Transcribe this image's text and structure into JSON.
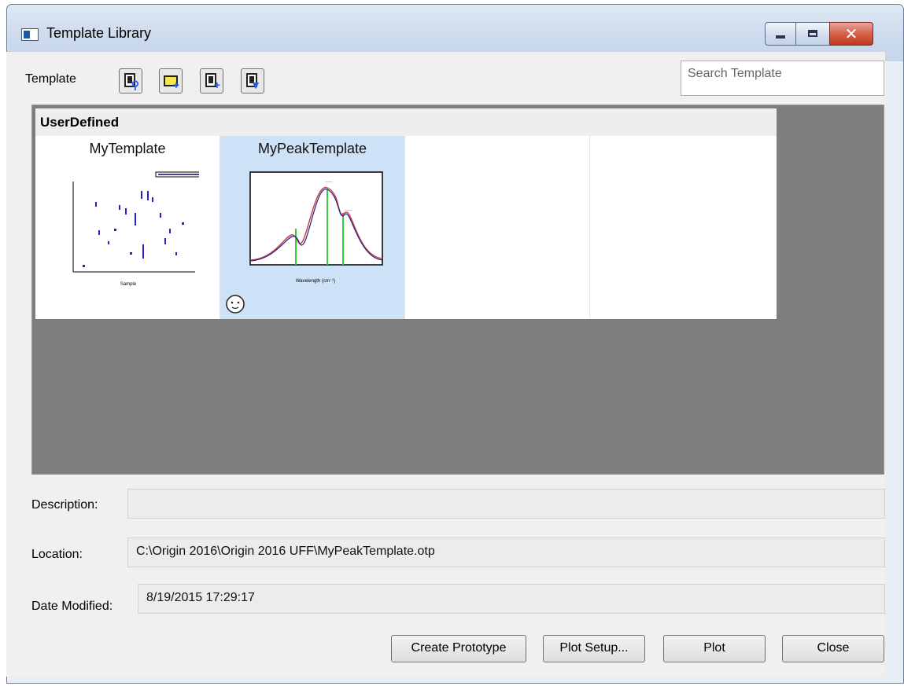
{
  "window": {
    "title": "Template Library"
  },
  "toolbar": {
    "label": "Template",
    "search_placeholder": "Search Template"
  },
  "gallery": {
    "group": "UserDefined",
    "templates": [
      {
        "name": "MyTemplate",
        "selected": false
      },
      {
        "name": "MyPeakTemplate",
        "selected": true
      }
    ]
  },
  "details": {
    "description_label": "Description:",
    "description_value": "",
    "location_label": "Location:",
    "location_value": "C:\\Origin 2016\\Origin 2016 UFF\\MyPeakTemplate.otp",
    "date_label": "Date Modified:",
    "date_value": "8/19/2015 17:29:17"
  },
  "buttons": {
    "create_prototype": "Create Prototype",
    "plot_setup": "Plot Setup...",
    "plot": "Plot",
    "close": "Close"
  },
  "colors": {
    "selection": "#cde1f7",
    "gallery_bg": "#7e7e7e",
    "window_frame": "#c4d4ea",
    "close_button": "#c0391f"
  }
}
